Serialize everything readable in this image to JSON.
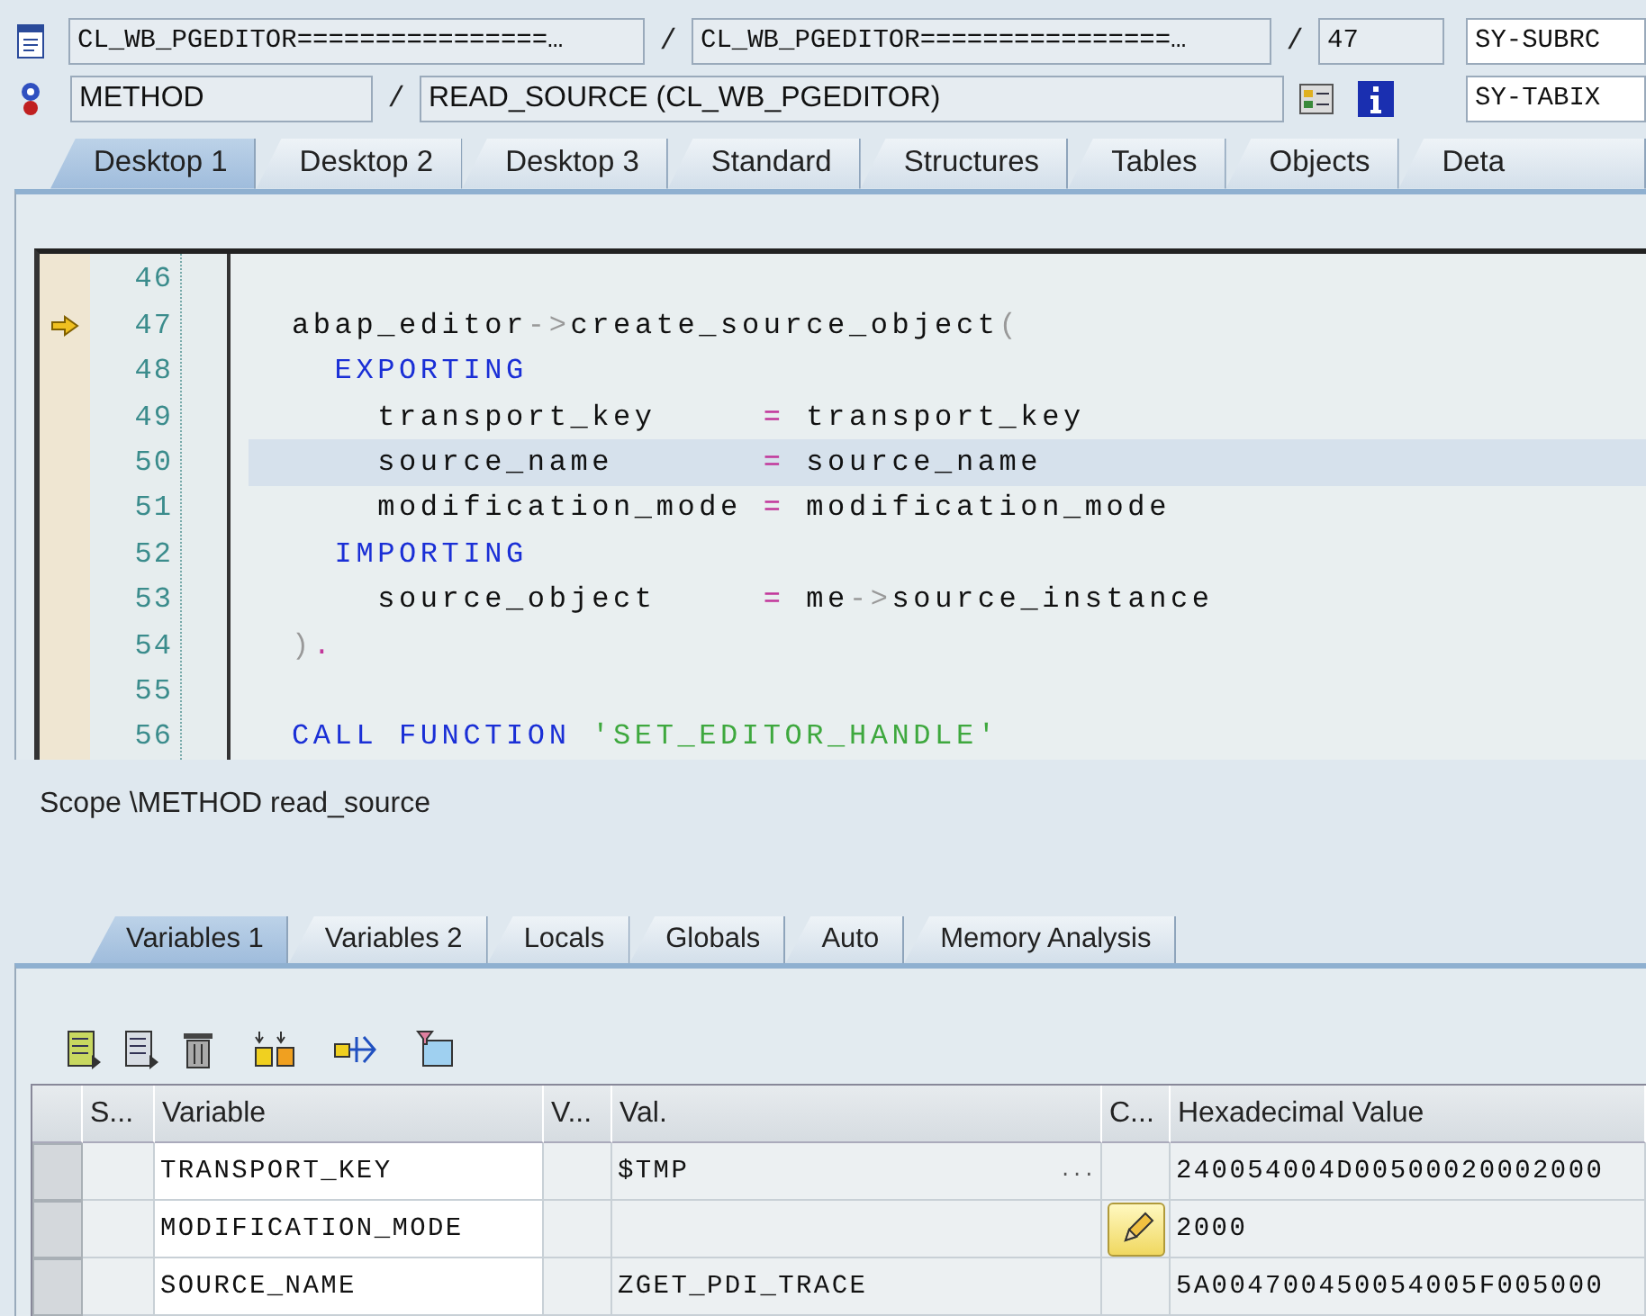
{
  "location": {
    "program": "CL_WB_PGEDITOR================…",
    "include": "CL_WB_PGEDITOR================…",
    "line": "47",
    "event_type": "METHOD",
    "event": "READ_SOURCE (CL_WB_PGEDITOR)",
    "separators": [
      "/",
      "/",
      "/"
    ]
  },
  "system_fields": [
    "SY-SUBRC",
    "SY-TABIX"
  ],
  "desktop_tabs": [
    {
      "label": "Desktop 1",
      "selected": true
    },
    {
      "label": "Desktop 2",
      "selected": false
    },
    {
      "label": "Desktop 3",
      "selected": false
    },
    {
      "label": "Standard",
      "selected": false
    },
    {
      "label": "Structures",
      "selected": false
    },
    {
      "label": "Tables",
      "selected": false
    },
    {
      "label": "Objects",
      "selected": false
    },
    {
      "label": "Deta",
      "selected": false
    }
  ],
  "editor": {
    "lines": [
      {
        "number": "46",
        "current": false,
        "highlighted": false
      },
      {
        "number": "47",
        "current": true,
        "highlighted": false,
        "tokens": [
          {
            "kind": "plain",
            "text": "abap_editor"
          },
          {
            "kind": "arrow",
            "text": "->"
          },
          {
            "kind": "plain",
            "text": "create_source_object"
          },
          {
            "kind": "arrow",
            "text": "("
          }
        ]
      },
      {
        "number": "48",
        "current": false,
        "highlighted": false,
        "tokens": [
          {
            "kind": "keyword",
            "text": "  EXPORTING"
          }
        ]
      },
      {
        "number": "49",
        "current": false,
        "highlighted": false,
        "tokens": [
          {
            "kind": "plain",
            "text": "    transport_key     "
          },
          {
            "kind": "operator",
            "text": "="
          },
          {
            "kind": "plain",
            "text": " transport_key"
          }
        ]
      },
      {
        "number": "50",
        "current": false,
        "highlighted": true,
        "tokens": [
          {
            "kind": "plain",
            "text": "    source_name       "
          },
          {
            "kind": "operator",
            "text": "="
          },
          {
            "kind": "plain",
            "text": " source_name"
          }
        ]
      },
      {
        "number": "51",
        "current": false,
        "highlighted": false,
        "tokens": [
          {
            "kind": "plain",
            "text": "    modification_mode "
          },
          {
            "kind": "operator",
            "text": "="
          },
          {
            "kind": "plain",
            "text": " modification_mode"
          }
        ]
      },
      {
        "number": "52",
        "current": false,
        "highlighted": false,
        "tokens": [
          {
            "kind": "keyword",
            "text": "  IMPORTING"
          }
        ]
      },
      {
        "number": "53",
        "current": false,
        "highlighted": false,
        "tokens": [
          {
            "kind": "plain",
            "text": "    source_object     "
          },
          {
            "kind": "operator",
            "text": "="
          },
          {
            "kind": "plain",
            "text": " me"
          },
          {
            "kind": "arrow",
            "text": "->"
          },
          {
            "kind": "plain",
            "text": "source_instance"
          }
        ]
      },
      {
        "number": "54",
        "current": false,
        "highlighted": false,
        "tokens": [
          {
            "kind": "arrow",
            "text": ")"
          },
          {
            "kind": "operator",
            "text": "."
          }
        ]
      },
      {
        "number": "55",
        "current": false,
        "highlighted": false
      },
      {
        "number": "56",
        "current": false,
        "highlighted": false,
        "tokens": [
          {
            "kind": "keyword",
            "text": "CALL FUNCTION "
          },
          {
            "kind": "string",
            "text": "'SET_EDITOR_HANDLE'"
          }
        ]
      }
    ]
  },
  "scope": "Scope \\METHOD read_source",
  "tool_tabs": [
    {
      "label": "Variables 1",
      "selected": true
    },
    {
      "label": "Variables 2",
      "selected": false
    },
    {
      "label": "Locals",
      "selected": false
    },
    {
      "label": "Globals",
      "selected": false
    },
    {
      "label": "Auto",
      "selected": false
    },
    {
      "label": "Memory Analysis",
      "selected": false
    }
  ],
  "variables_table": {
    "columns": [
      "S...",
      "Variable",
      "V...",
      "Val.",
      "C...",
      "Hexadecimal Value"
    ],
    "rows": [
      {
        "variable": "TRANSPORT_KEY",
        "value": "$TMP",
        "value_more": "...",
        "editable": false,
        "hex": "240054004D00500020002000"
      },
      {
        "variable": "MODIFICATION_MODE",
        "editable": true,
        "hex": "2000"
      },
      {
        "variable": "SOURCE_NAME",
        "value": "ZGET_PDI_TRACE",
        "editable": false,
        "hex": "5A004700450054005F005000"
      }
    ]
  }
}
